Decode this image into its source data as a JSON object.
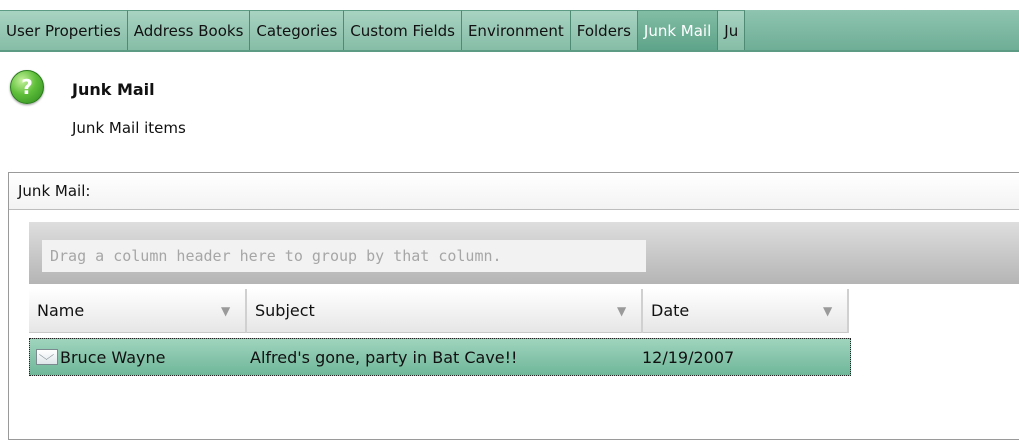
{
  "tabs": [
    {
      "label": "User Properties"
    },
    {
      "label": "Address Books"
    },
    {
      "label": "Categories"
    },
    {
      "label": "Custom Fields"
    },
    {
      "label": "Environment"
    },
    {
      "label": "Folders"
    },
    {
      "label": "Junk Mail",
      "active": true
    },
    {
      "label": "Ju"
    }
  ],
  "header": {
    "icon": "help-icon",
    "title": "Junk Mail",
    "subtitle": "Junk Mail items"
  },
  "panel": {
    "title": "Junk Mail:",
    "group_hint": "Drag a column header here to group by that column.",
    "columns": [
      "Name",
      "Subject",
      "Date"
    ],
    "rows": [
      {
        "name": "Bruce Wayne",
        "subject": "Alfred's gone, party in Bat Cave!!",
        "date": "12/19/2007",
        "icon": "envelope-icon",
        "selected": true
      }
    ]
  },
  "colors": {
    "tab_bg": "#86bda7",
    "tab_active_text": "#ffffff",
    "row_selected_bg": "#6fb79a"
  }
}
